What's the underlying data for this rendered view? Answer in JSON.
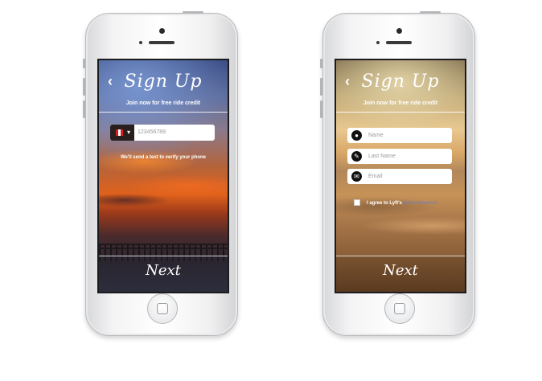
{
  "left_screen": {
    "title": "Sign Up",
    "back_icon": "‹",
    "subtitle": "Join now for free ride credit",
    "country_flag": "flag-icon",
    "caret": "▾",
    "phone_placeholder": "123456789",
    "info_text": "We'll send a text to verify your phone",
    "next_label": "Next"
  },
  "right_screen": {
    "title": "Sign Up",
    "back_icon": "‹",
    "subtitle": "Join now for free ride credit",
    "fields": [
      {
        "icon": "user-icon",
        "glyph": "●",
        "placeholder": "Name"
      },
      {
        "icon": "pencil-icon",
        "glyph": "✎",
        "placeholder": "Last Name"
      },
      {
        "icon": "mail-icon",
        "glyph": "✉",
        "placeholder": "Email"
      }
    ],
    "agree_text": "I agree to Lyft's",
    "terms_link": "terms of service",
    "next_label": "Next"
  },
  "colors": {
    "link": "#6c7fbf",
    "phone_body": "#f4f4f5",
    "next_brown": "#6a4528"
  }
}
